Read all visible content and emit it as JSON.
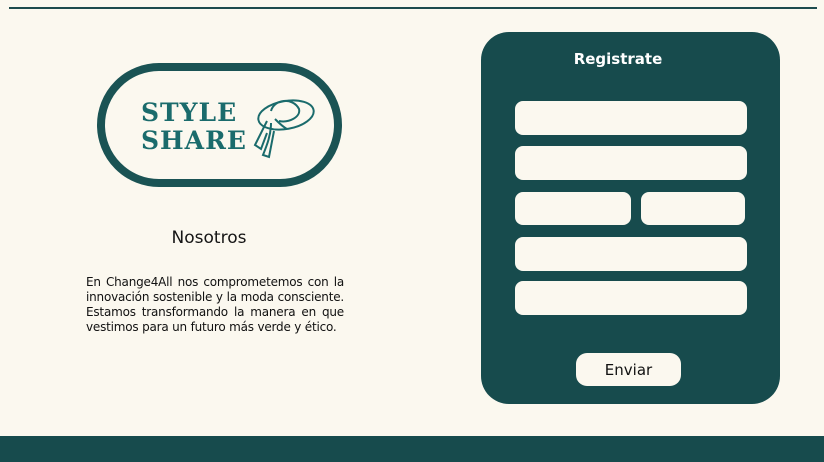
{
  "logo": {
    "line1": "STYLE",
    "line2": "SHARE"
  },
  "about": {
    "title": "Nosotros",
    "text": "En Change4All nos comprometemos con la innovación sostenible y la moda consciente. Estamos transformando la manera en que vestimos para un futuro más verde y ético."
  },
  "form": {
    "title": "Registrate",
    "fields": [
      "",
      "",
      "",
      "",
      "",
      ""
    ],
    "submit_label": "Enviar"
  },
  "colors": {
    "brand_dark": "#174b4d",
    "logo_teal": "#1a6b6c",
    "background": "#fbf8ef"
  }
}
